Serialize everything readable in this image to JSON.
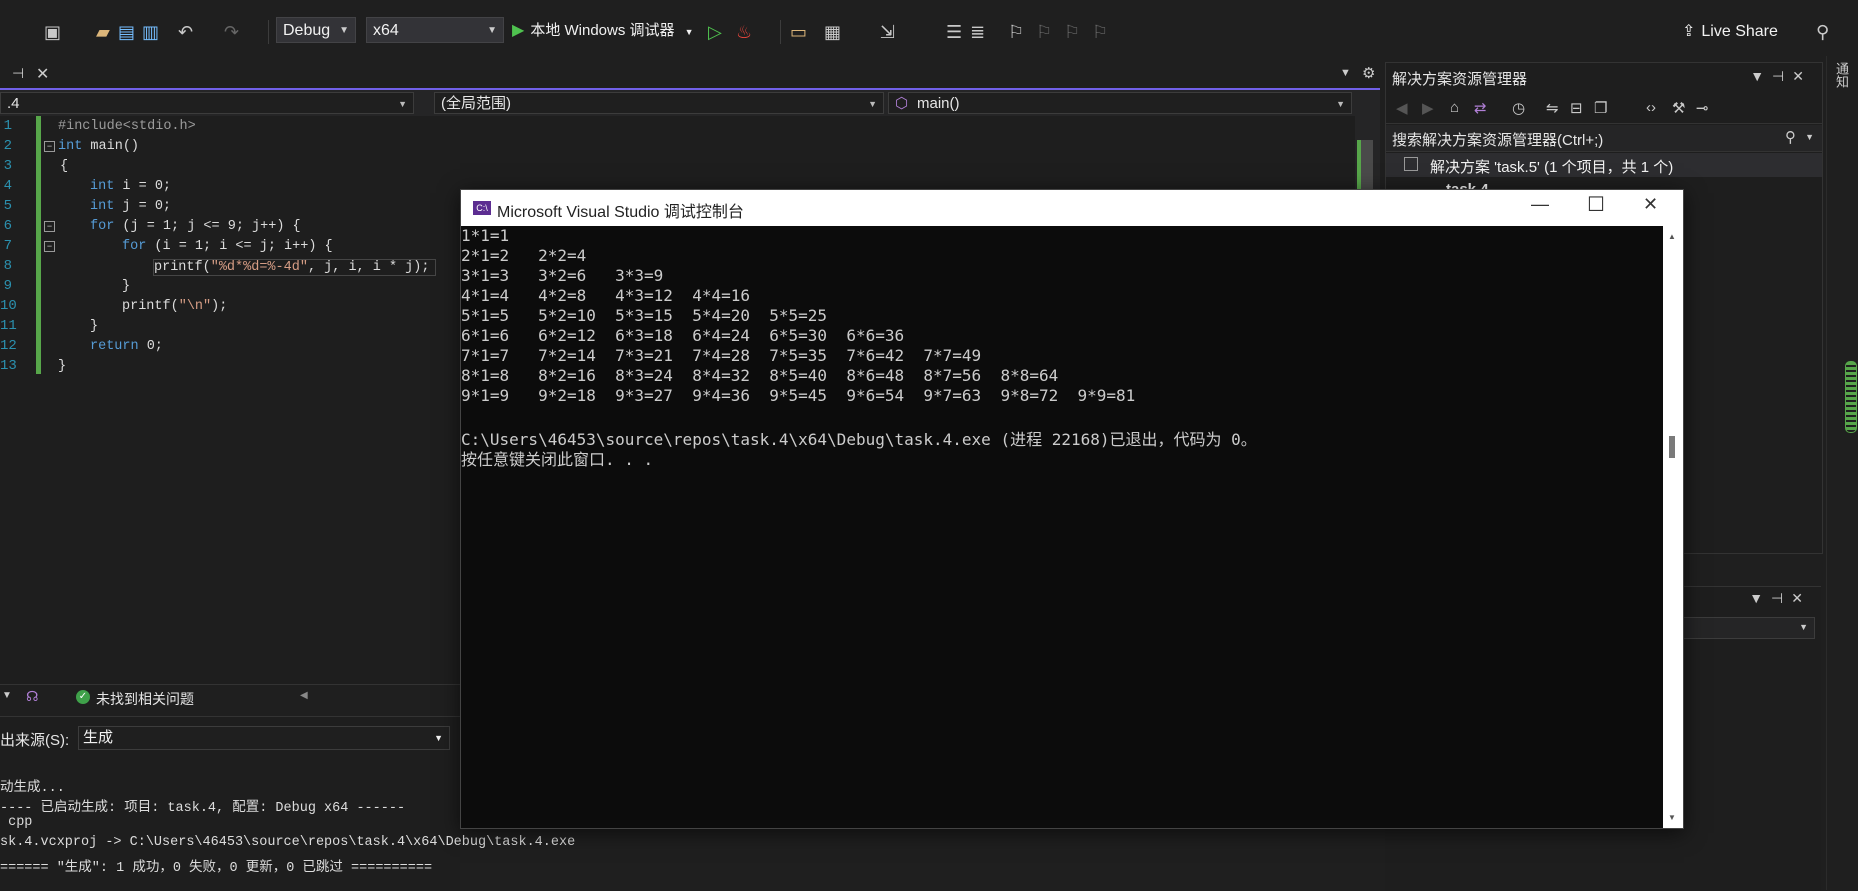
{
  "toolbar": {
    "config": "Debug",
    "platform": "x64",
    "run_label": "本地 Windows 调试器",
    "live_share": "Live Share"
  },
  "editor": {
    "tab_name": ".4",
    "nav_scope": "(全局范围)",
    "nav_member": "main()",
    "line_numbers": [
      "1",
      "2",
      "3",
      "4",
      "5",
      "6",
      "7",
      "8",
      "9",
      "10",
      "11",
      "12",
      "13"
    ],
    "status_text": "未找到相关问题"
  },
  "code": {
    "l1": "#include<stdio.h>",
    "l2_kw": "int",
    "l2_rest": " main()",
    "l3": "{",
    "l4_kw": "int",
    "l4_rest": " i = 0;",
    "l5_kw": "int",
    "l5_rest": " j = 0;",
    "l6_kw": "for",
    "l6_rest": " (j = 1; j <= 9; j++) {",
    "l7_kw": "for",
    "l7_rest": " (i = 1; i <= j; i++) {",
    "l8_pre": "printf(",
    "l8_str": "\"%d*%d=%-4d\"",
    "l8_post": ", j, i, i * j);",
    "l9": "}",
    "l10_pre": "printf(",
    "l10_str": "\"\\n\"",
    "l10_post": ");",
    "l11": "}",
    "l12_kw": "return",
    "l12_rest": " 0;",
    "l13": "}"
  },
  "output": {
    "source_label": "出来源(S):",
    "source_value": "生成",
    "lines": [
      "动生成...",
      "---- 已启动生成: 项目: task.4, 配置: Debug x64 ------",
      " cpp",
      "sk.4.vcxproj -> C:\\Users\\46453\\source\\repos\\task.4\\x64\\Debug\\task.4.exe",
      "====== \"生成\": 1 成功，0 失败，0 更新，0 已跳过 =========="
    ]
  },
  "solution_explorer": {
    "title": "解决方案资源管理器",
    "search_placeholder": "搜索解决方案资源管理器(Ctrl+;)",
    "solution_label": "解决方案 'task.5' (1 个项目，共 1 个)",
    "project_label": "task.4"
  },
  "right_strip": {
    "vertical_text": "通知"
  },
  "console": {
    "title": "Microsoft Visual Studio 调试控制台",
    "icon_text": "C:\\",
    "lines": [
      "1*1=1",
      "2*1=2   2*2=4",
      "3*1=3   3*2=6   3*3=9",
      "4*1=4   4*2=8   4*3=12  4*4=16",
      "5*1=5   5*2=10  5*3=15  5*4=20  5*5=25",
      "6*1=6   6*2=12  6*3=18  6*4=24  6*5=30  6*6=36",
      "7*1=7   7*2=14  7*3=21  7*4=28  7*5=35  7*6=42  7*7=49",
      "8*1=8   8*2=16  8*3=24  8*4=32  8*5=40  8*6=48  8*7=56  8*8=64",
      "9*1=9   9*2=18  9*3=27  9*4=36  9*5=45  9*6=54  9*7=63  9*8=72  9*9=81",
      "",
      "C:\\Users\\46453\\source\\repos\\task.4\\x64\\Debug\\task.4.exe (进程 22168)已退出，代码为 0。",
      "按任意键关闭此窗口. . ."
    ]
  },
  "colors": {
    "accent": "#7160e8",
    "keyword": "#569cd6",
    "string": "#d69d85",
    "change_bar": "#57a64a"
  }
}
